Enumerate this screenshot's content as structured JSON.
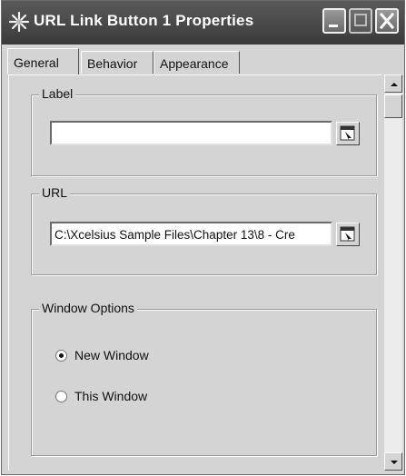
{
  "window": {
    "title": "URL Link Button 1 Properties",
    "icon": "starburst-icon",
    "controls": [
      "minimize-icon",
      "maximize-icon",
      "close-icon"
    ]
  },
  "tabs": [
    {
      "label": "General",
      "active": true
    },
    {
      "label": "Behavior",
      "active": false
    },
    {
      "label": "Appearance",
      "active": false
    }
  ],
  "label_group": {
    "title": "Label",
    "value": "",
    "picker_icon": "cell-selector-icon"
  },
  "url_group": {
    "title": "URL",
    "value": "C:\\Xcelsius Sample Files\\Chapter 13\\8 - Cre",
    "picker_icon": "cell-selector-icon"
  },
  "window_options": {
    "title": "Window Options",
    "options": [
      {
        "label": "New Window",
        "selected": true
      },
      {
        "label": "This Window",
        "selected": false
      }
    ]
  },
  "scrollbar": {
    "up_icon": "arrow-up-icon",
    "down_icon": "arrow-down-icon"
  }
}
